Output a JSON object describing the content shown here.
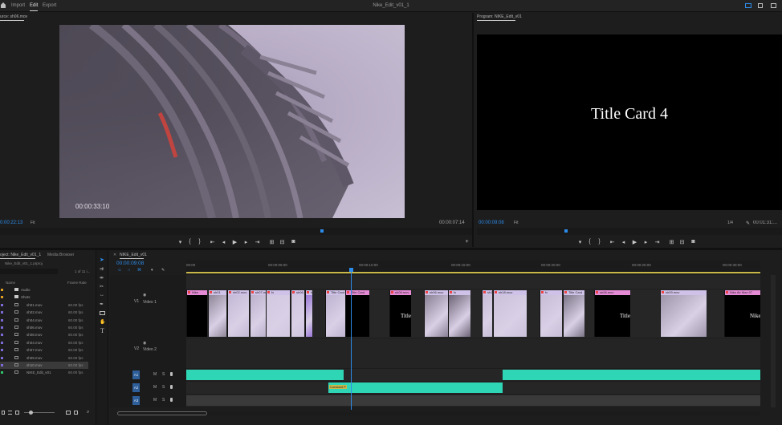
{
  "menu": {
    "home_icon": "home-icon",
    "import": "Import",
    "edit": "Edit",
    "export": "Export",
    "doc_title": "Nike_Edit_v01_1"
  },
  "source": {
    "tab": "urce: sh06.mov",
    "overlay_tc": "00:00:33:10",
    "tc_current": "0:00:22:13",
    "fit": "Fit",
    "tc_duration": "00:00:07:14"
  },
  "program": {
    "tab": "Program: NIKE_Edit_v01",
    "title_card": "Title Card 4",
    "tc_current": "00:00:09:08",
    "fit": "Fit",
    "scale": "1/4",
    "tc_duration": "00:01:31:..."
  },
  "project": {
    "tab": "oject: Nike_Edit_v01_1",
    "tab2": "Media Browser",
    "file": "Nike_Edit_v01_1.prproj",
    "count": "1 of 11 i...",
    "col_name": "Name",
    "col_rate": "Frame Rate",
    "items": [
      {
        "name": "Audio",
        "rate": ""
      },
      {
        "name": "Shots",
        "rate": ""
      },
      {
        "name": "sh01.mov",
        "rate": "60.00 fps"
      },
      {
        "name": "sh02.mov",
        "rate": "60.00 fps"
      },
      {
        "name": "sh04.mov",
        "rate": "60.00 fps"
      },
      {
        "name": "sh06.mov",
        "rate": "60.00 fps"
      },
      {
        "name": "sh08.mov",
        "rate": "60.00 fps"
      },
      {
        "name": "sh04.mov",
        "rate": "60.00 fps"
      },
      {
        "name": "sh07.mov",
        "rate": "60.00 fps"
      },
      {
        "name": "sh09.mov",
        "rate": "60.00 fps"
      },
      {
        "name": "sh10.mov",
        "rate": "60.00 fps"
      },
      {
        "name": "NIKE_Edit_v01",
        "rate": "60.00 fps"
      }
    ]
  },
  "timeline": {
    "tab": "NIKE_Edit_v01",
    "tc": "00:00:09:08",
    "ruler": [
      "00:00",
      "00:00:05:00",
      "00:00:10:00",
      "00:00:15:00",
      "00:00:20:00",
      "00:00:25:00",
      "00:00:30:00"
    ],
    "tracks": {
      "v2": "V2",
      "v1": "V1",
      "video1": "Video 1",
      "video2": "Video 2",
      "a1": "A1",
      "a2": "A2",
      "a3": "A3",
      "m": "M",
      "s": "S"
    },
    "clips": [
      "Nike",
      "sh01",
      "sh02.mov",
      "sh07.mov",
      "fx",
      "sh06.mov",
      "fx",
      "Title Card 4",
      "Title Card",
      "sh08.mov",
      "sh06.mov",
      "fx",
      "sh11.mov [97%]",
      "sh18.mov",
      "fx",
      "Title Card",
      "sh06.mov",
      "sh09.mov",
      "Nike Air Max 97"
    ],
    "title_texts": [
      "Title",
      "Title",
      "Nike"
    ],
    "audio_label": "Constant P"
  },
  "colors": {
    "accent": "#2d8ceb",
    "audio": "#2fd6b6",
    "video_clip": "#cfc2e8",
    "title_clip": "#e58ad5"
  }
}
